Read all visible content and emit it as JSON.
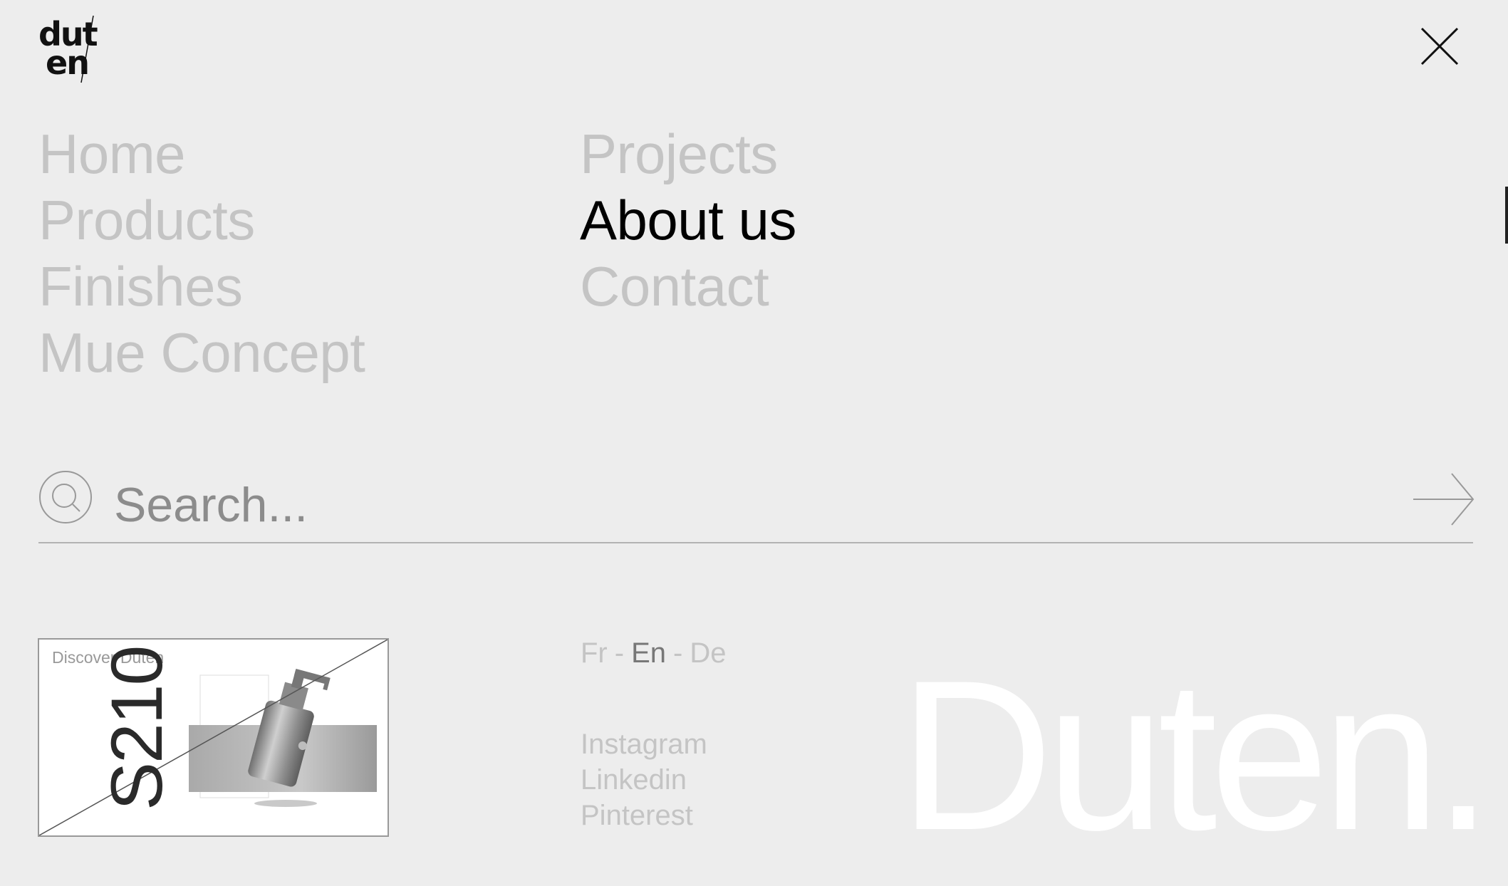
{
  "logo": {
    "line1": "dut",
    "line2": "en"
  },
  "nav": {
    "left": [
      {
        "label": "Home"
      },
      {
        "label": "Products"
      },
      {
        "label": "Finishes"
      },
      {
        "label": "Mue Concept"
      }
    ],
    "right": [
      {
        "label": "Projects"
      },
      {
        "label": "About us"
      },
      {
        "label": "Contact"
      }
    ],
    "active": "About us"
  },
  "search": {
    "placeholder": "Search..."
  },
  "promo": {
    "label": "Discover Duten",
    "code": "S210"
  },
  "languages": {
    "items": [
      "Fr",
      "En",
      "De"
    ],
    "separator": "-",
    "active": "En"
  },
  "social": [
    "Instagram",
    "Linkedin",
    "Pinterest"
  ],
  "brand": {
    "wordmark": "Duten."
  },
  "colors": {
    "background": "#ededed",
    "nav_inactive": "#c4c4c4",
    "nav_active": "#000000",
    "wordmark": "#ffffff"
  },
  "icons": {
    "close": "close-icon",
    "search": "search-icon",
    "submit": "arrow-right-icon"
  }
}
